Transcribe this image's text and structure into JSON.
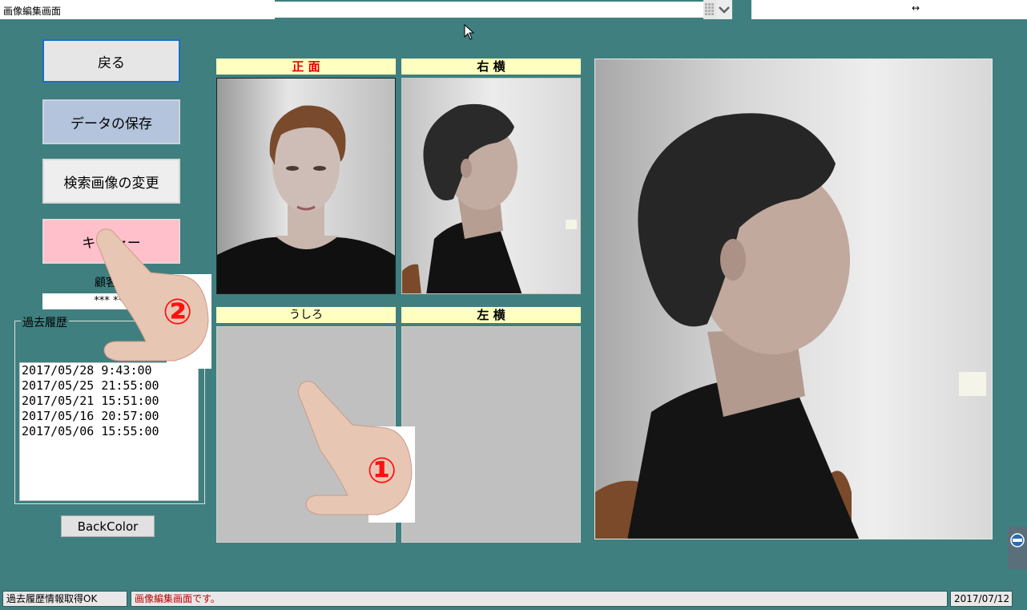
{
  "window": {
    "title": "画像編集画面"
  },
  "buttons": {
    "back": "戻る",
    "save": "データの保存",
    "change_search": "検索画像の変更",
    "cancel": "キャ     ャー",
    "backcolor": "BackColor"
  },
  "customer": {
    "label": "顧客名",
    "name": "*** ***"
  },
  "history": {
    "title": "過去履歴",
    "items": [
      "2017/05/28 9:43:00",
      "2017/05/25 21:55:00",
      "2017/05/21 15:51:00",
      "2017/05/16 20:57:00",
      "2017/05/06 15:55:00"
    ]
  },
  "panels": {
    "front": "正 面",
    "right_side": "右 横",
    "back": "うしろ",
    "left_side": "左 横"
  },
  "overlays": {
    "marker1": "①",
    "marker2": "②"
  },
  "status": {
    "left": "過去履歴情報取得OK",
    "message": "画像編集画面です。",
    "date": "2017/07/12"
  },
  "colors": {
    "background": "#3f7f7f",
    "label_bg": "#ffffc0",
    "front_label": "#e00000",
    "cancel_bg": "#ffc0cb",
    "save_bg": "#b4c4dc"
  }
}
